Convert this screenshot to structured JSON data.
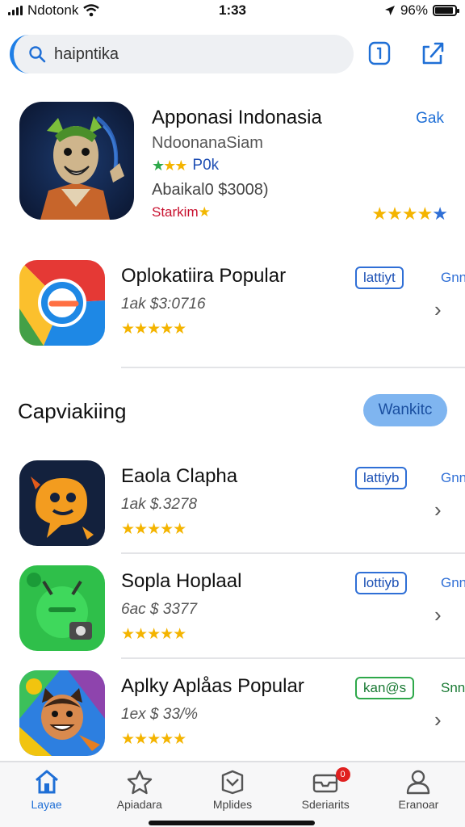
{
  "status_bar": {
    "carrier": "Ndotonk",
    "time": "1:33",
    "battery_text": "96%"
  },
  "search": {
    "query": "haipntika"
  },
  "featured": {
    "title": "Apponasi Indonasia",
    "get_label": "Gak",
    "subtitle": "NdoonanaSiam",
    "rating_count": "P0k",
    "price": "Abaikal0 $3008)",
    "badge": "Starkim",
    "rating": 3.5
  },
  "apps": [
    {
      "name": "Oplokatiira Popular",
      "price": "1ak $3:0716",
      "rating": 4.5,
      "button_label": "lattiyt",
      "button_side_label": "Gnn",
      "button_style": "blue",
      "icon": "chrome-like-icon"
    },
    {
      "name": "Eaola Clapha",
      "price": "1ak $.3278",
      "rating": 4.5,
      "button_label": "lattiyb",
      "button_side_label": "Gnn",
      "button_style": "blue",
      "icon": "chat-bubble-icon"
    },
    {
      "name": "Sopla Hoplaal",
      "price": "6ac $ 3377",
      "rating": 5,
      "button_label": "lottiyb",
      "button_side_label": "Gnn",
      "button_style": "blue",
      "icon": "green-robot-icon"
    },
    {
      "name": "Aplky Aplåas Popular",
      "price": "1ex $ 33/%",
      "rating": 4.5,
      "button_label": "kan@s",
      "button_side_label": "Snn",
      "button_style": "green",
      "icon": "cartoon-face-icon"
    }
  ],
  "section": {
    "title": "Capviakiing",
    "button_label": "Wankitc"
  },
  "tab_bar": {
    "tabs": [
      {
        "label": "Layae",
        "icon": "home-icon",
        "active": true
      },
      {
        "label": "Apiadara",
        "icon": "star-icon",
        "active": false
      },
      {
        "label": "Mplides",
        "icon": "layers-icon",
        "active": false
      },
      {
        "label": "Sderiarits",
        "icon": "inbox-icon",
        "active": false,
        "badge": "0"
      },
      {
        "label": "Eranoar",
        "icon": "person-icon",
        "active": false
      }
    ]
  },
  "colors": {
    "accent": "#1f6fd6",
    "star": "#f4b400",
    "section_button_bg": "#7fb5f0"
  }
}
